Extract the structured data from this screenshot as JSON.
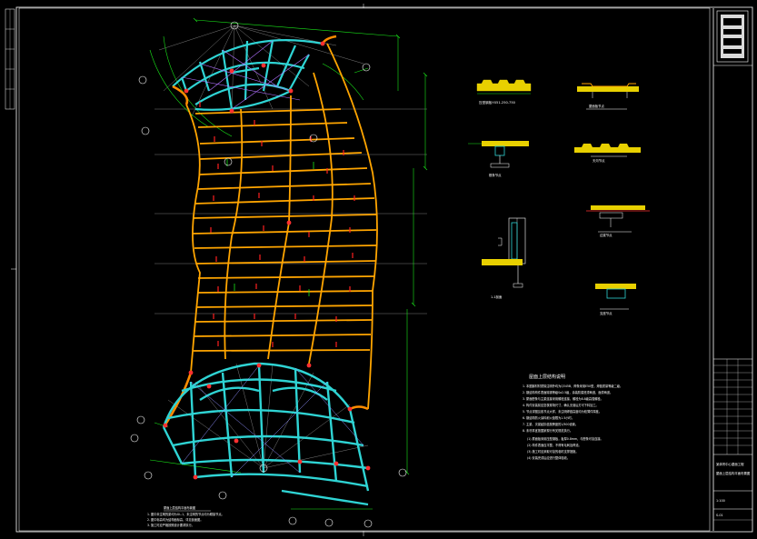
{
  "colors": {
    "background": "#000000",
    "frame": "#ffffff",
    "beam_main": "#ffa500",
    "beam_secondary": "#ffcc33",
    "edge_beam": "#ff8c00",
    "dome_beam": "#2fd4d4",
    "node": "#ff3030",
    "dimension": "#19e619",
    "axis": "#c0c0c0",
    "hatch": "#c8ff00",
    "detail_fill": "#e8d000",
    "marker": "#ff2020"
  },
  "icons": {
    "axis_bubble": "circle-axis-marker-icon",
    "node": "steel-node-icon",
    "section_mark": "section-cut-icon",
    "north_logo": "seal-logo-icon"
  },
  "notes": {
    "title": "屋面上层结构说明",
    "lines": [
      "1. 本图钢材材质除注明外均为Q345B，焊条采用E50型，焊缝质量等级二级。",
      "2. 钢结构构件表面除锈等级Sa2.5级，涂装防腐底漆两道，面漆两道。",
      "3. 屋面檩条与主梁连接采用螺栓连接，螺栓为8.8级高强螺栓。",
      "4. 构件安装前应复核现场尺寸，确认无误后方可下料加工。",
      "5. 节点详图见各节点大样，未注明焊缝高度均为较薄件厚度。",
      "6. 钢结构防火涂料耐火极限为1.5小时。",
      "7. 主梁、次梁起拱值按跨度的1/500设置。",
      "8. 未尽事宜按国家现行有关规范执行。",
      "(1) 屋面板采用压型钢板，板厚0.8mm，与檩条可靠连接。",
      "(2) 构件表面应平整，不得有毛刺及焊渣。",
      "(3) 施工时应采取可靠的临时支撑措施。",
      "(4) 安装完成后应进行整体验收。"
    ]
  },
  "plan_notes": {
    "title": "屋面上层结构平面布置图",
    "lines": [
      "1. 图中未注明的梁均为GL-1，未注明的节点均为刚接节点。",
      "2. 图中标高均为结构面标高，详见剖面图。",
      "3. 施工时应严格按照设计要求执行。"
    ]
  },
  "details": [
    {
      "label": "压型钢板YX51-250-750"
    },
    {
      "label": "屋面板节点"
    },
    {
      "label": "檩条节点"
    },
    {
      "label": "天沟节点"
    },
    {
      "label": "边梁节点"
    },
    {
      "label": "1-1剖面"
    },
    {
      "label": "支座节点"
    }
  ],
  "title_block": {
    "project": "某体育中心屋面工程",
    "drawing_name": "屋面上层结构平面布置图",
    "scale": "1:100",
    "sheet": "S-01"
  }
}
